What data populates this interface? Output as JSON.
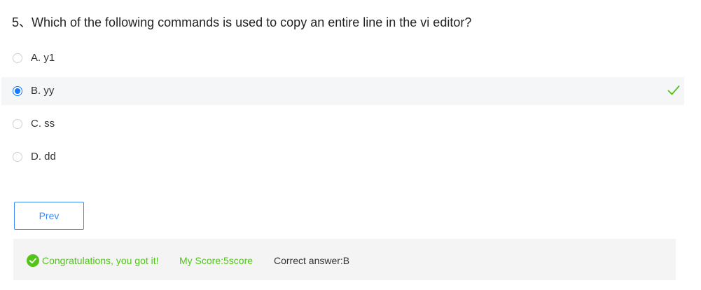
{
  "question": {
    "text": "5、Which of the following commands is used to copy an entire line in the vi editor?"
  },
  "options": [
    {
      "label": "A. y1",
      "selected": false
    },
    {
      "label": "B. yy",
      "selected": true,
      "correct_mark": "check-icon"
    },
    {
      "label": "C. ss",
      "selected": false
    },
    {
      "label": "D. dd",
      "selected": false
    }
  ],
  "navigation": {
    "prev_label": "Prev"
  },
  "result": {
    "icon": "check-circle-icon",
    "message": "Congratulations, you got it!",
    "score": "My Score:5score",
    "correct_answer": "Correct answer:B"
  },
  "colors": {
    "accent": "#3d8af7",
    "radio_selected": "#1677ff",
    "success": "#52c41a",
    "selected_row_bg": "#f5f6f7",
    "result_bg": "#f4f4f4"
  }
}
